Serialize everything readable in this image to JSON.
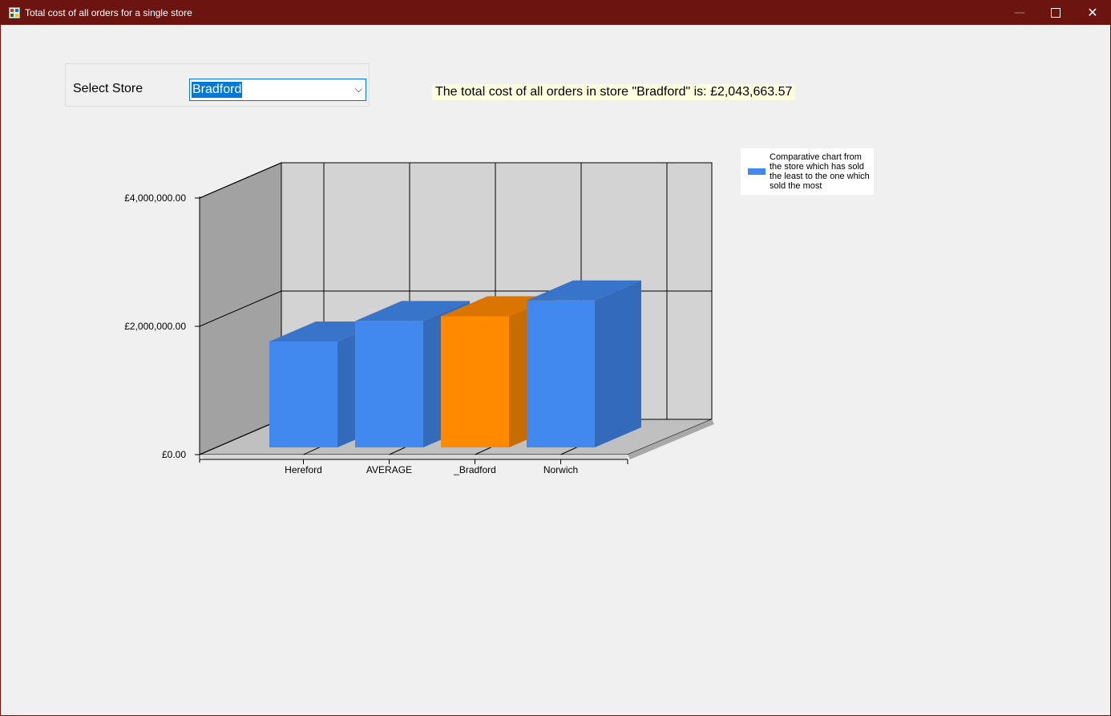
{
  "window": {
    "title": "Total cost of all orders for a single store",
    "min_glyph": "—",
    "close_glyph": "✕",
    "icons": {
      "app": "form-app-icon",
      "minimize": "minimize-icon",
      "maximize": "maximize-icon",
      "close": "close-icon"
    }
  },
  "store_select": {
    "label": "Select Store",
    "selected_value": "Bradford",
    "chevron": "⌵"
  },
  "total_text": "The total cost of all orders in store \"Bradford\"  is: £2,043,663.57",
  "legend": {
    "text": "Comparative chart from the store which has sold the least to the one which sold the most",
    "color": "#4189ee"
  },
  "chart_data": {
    "type": "bar",
    "style": "3d",
    "categories": [
      "Hereford",
      "AVERAGE",
      "_Bradford",
      "Norwich"
    ],
    "values": [
      1650000,
      1970000,
      2043663.57,
      2290000
    ],
    "colors": [
      "#4189ee",
      "#4189ee",
      "#ff8a00",
      "#4189ee"
    ],
    "y_tick_labels": [
      "£0.00",
      "£2,000,000.00",
      "£4,000,000.00"
    ],
    "y_ticks": [
      0,
      2000000,
      4000000
    ],
    "ylim": [
      0,
      4000000
    ],
    "grid": true,
    "legend_position": "right"
  }
}
